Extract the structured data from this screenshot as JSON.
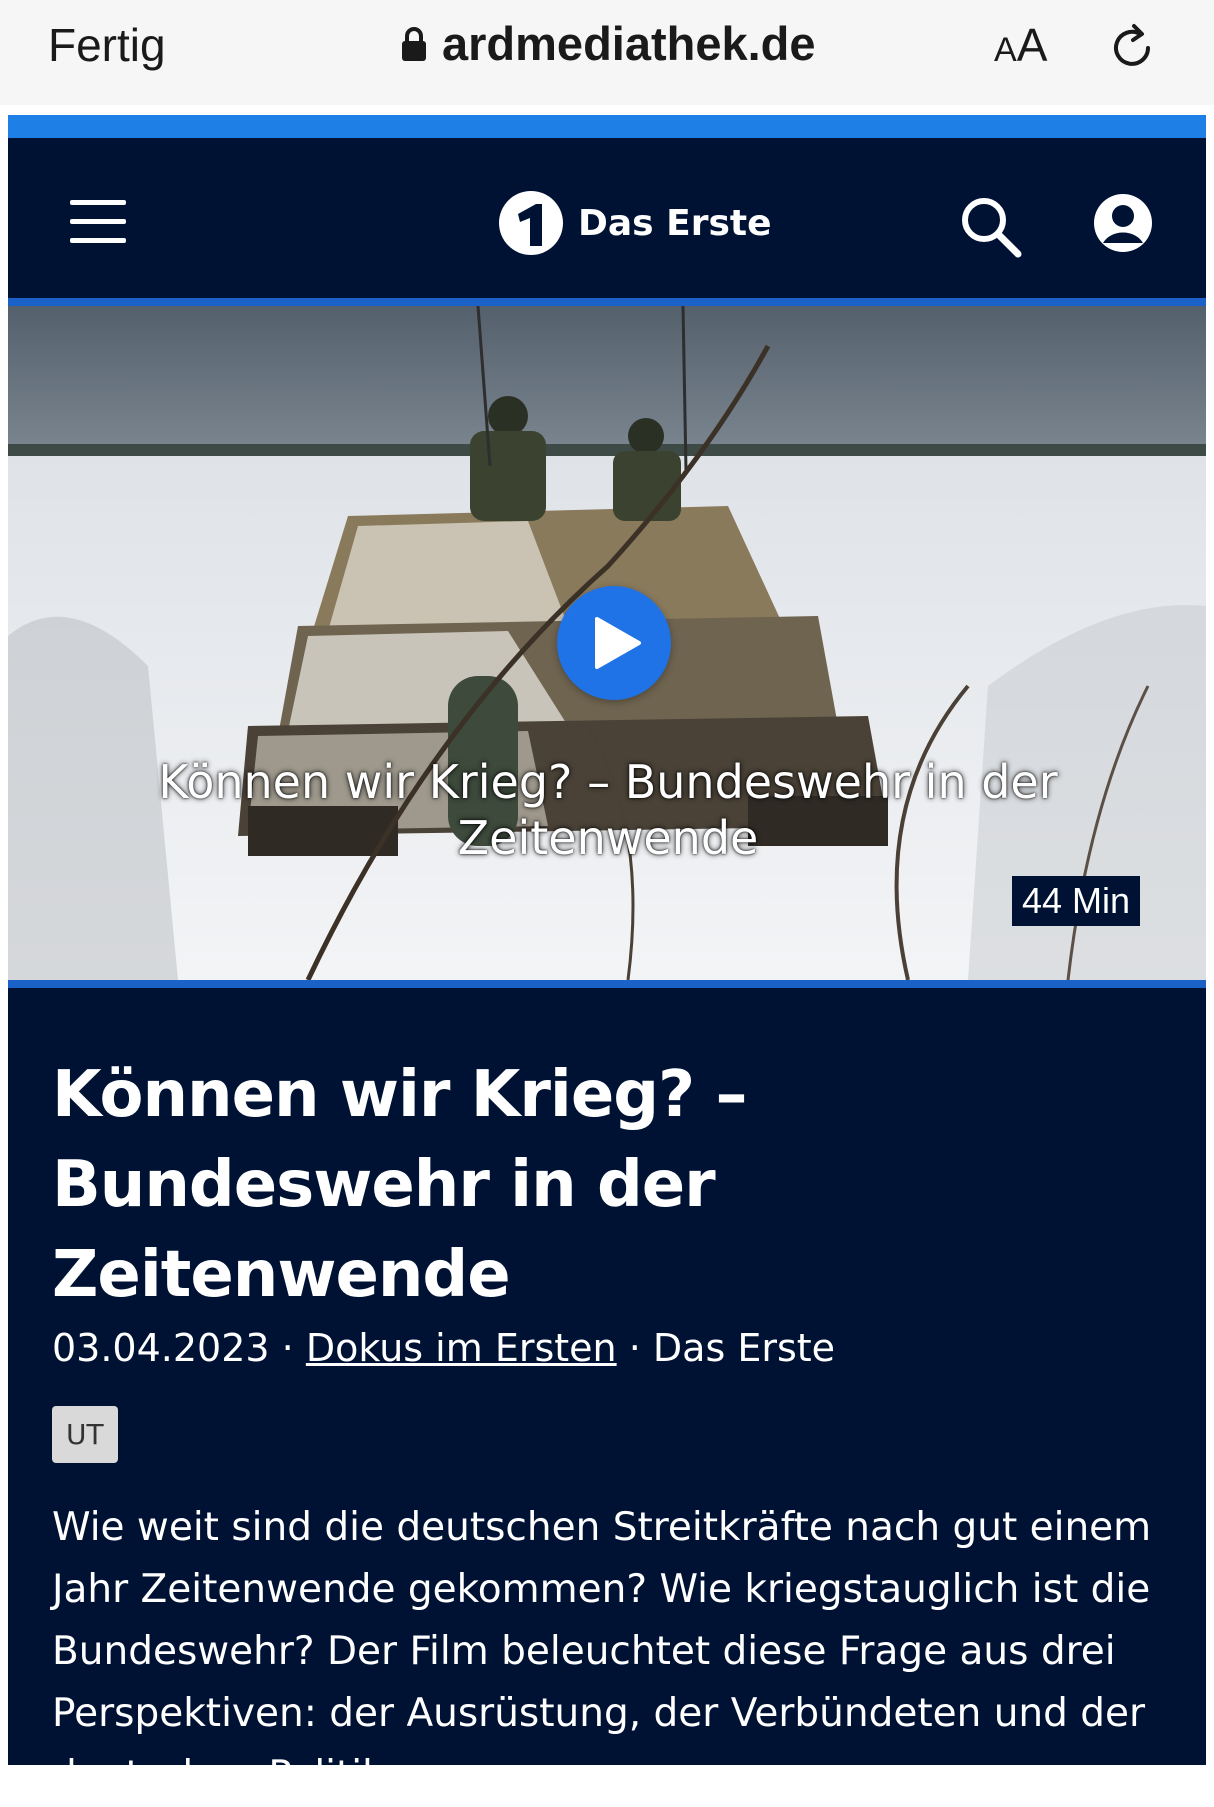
{
  "browser": {
    "done_label": "Fertig",
    "url": "ardmediathek.de",
    "text_size_small": "A",
    "text_size_big": "A"
  },
  "header": {
    "logo_number": "1",
    "logo_text": "Das Erste"
  },
  "player": {
    "overlay_title": "Können wir Krieg? – Bundeswehr in der Zeitenwende",
    "duration": "44 Min"
  },
  "details": {
    "title": "Können wir Krieg? – Bundeswehr in der Zeitenwende",
    "date": "03.04.2023",
    "separator": "·",
    "series_link": "Dokus im Ersten",
    "channel": "Das Erste",
    "badge": "UT",
    "description": "Wie weit sind die deutschen Streitkräfte nach gut einem Jahr Zeitenwende gekommen? Wie kriegstauglich ist die Bundeswehr? Der Film beleuchtet diese Frage aus drei Perspektiven: der Ausrüstung, der Verbündeten und der deutschen Politiker."
  },
  "colors": {
    "page_bg": "#001234",
    "accent_blue": "#1e80e6",
    "play_button": "#1f73e6",
    "browser_bar": "#f6f6f7"
  },
  "icons": [
    "lock-icon",
    "reload-icon",
    "menu-icon",
    "search-icon",
    "user-icon",
    "play-icon"
  ]
}
